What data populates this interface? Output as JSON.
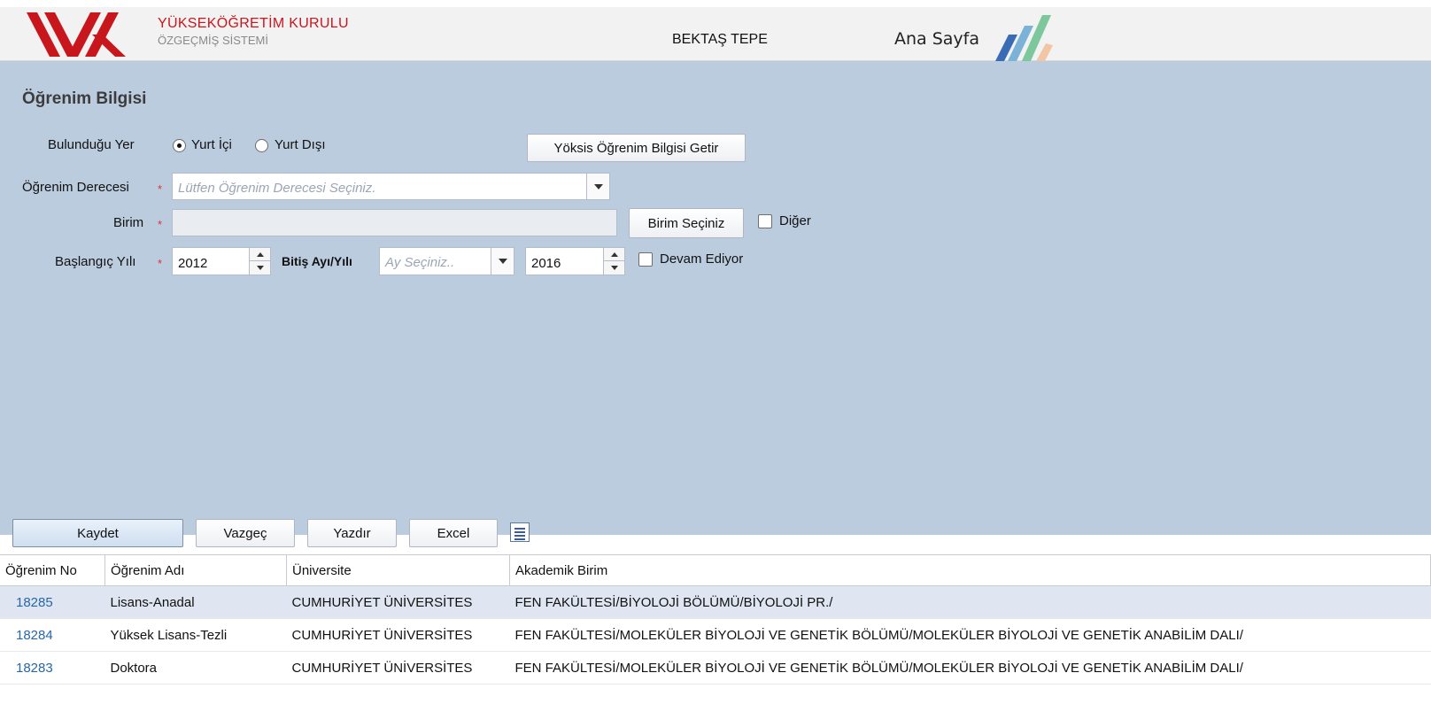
{
  "header": {
    "org_name": "YÜKSEKÖĞRETİM KURULU",
    "org_sub": "ÖZGEÇMİŞ SİSTEMİ",
    "user_name": "BEKTAŞ TEPE",
    "home_link": "Ana Sayfa",
    "logo_color": "#c8161d",
    "stripe_colors": [
      "#3a6cb5",
      "#7ab2d8",
      "#7cc79b",
      "#f2c6a4"
    ]
  },
  "form": {
    "title": "Öğrenim Bilgisi",
    "location_label": "Bulunduğu Yer",
    "location_options": [
      {
        "label": "Yurt İçi",
        "selected": true
      },
      {
        "label": "Yurt Dışı",
        "selected": false
      }
    ],
    "fetch_button": "Yöksis Öğrenim Bilgisi Getir",
    "degree_label": "Öğrenim Derecesi",
    "degree_placeholder": "Lütfen Öğrenim Derecesi Seçiniz.",
    "unit_label": "Birim",
    "unit_value": "",
    "unit_button": "Birim Seçiniz",
    "other_label": "Diğer",
    "other_checked": false,
    "start_label": "Başlangıç Yılı",
    "start_value": "2012",
    "end_label": "Bitiş Ayı/Yılı",
    "end_month_placeholder": "Ay Seçiniz..",
    "end_year_value": "2016",
    "ongoing_label": "Devam Ediyor",
    "ongoing_checked": false,
    "required_mark": "*"
  },
  "toolbar": {
    "save": "Kaydet",
    "cancel": "Vazgeç",
    "print": "Yazdır",
    "excel": "Excel",
    "list_icon": "list-icon"
  },
  "table": {
    "columns": [
      "Öğrenim No",
      "Öğrenim Adı",
      "Üniversite",
      "Akademik Birim"
    ],
    "rows": [
      {
        "no": "18285",
        "name": "Lisans-Anadal",
        "university": "CUMHURİYET ÜNİVERSİTES",
        "unit": "FEN FAKÜLTESİ/BİYOLOJİ BÖLÜMÜ/BİYOLOJİ PR./"
      },
      {
        "no": "18284",
        "name": "Yüksek Lisans-Tezli",
        "university": "CUMHURİYET ÜNİVERSİTES",
        "unit": "FEN FAKÜLTESİ/MOLEKÜLER BİYOLOJİ VE GENETİK BÖLÜMÜ/MOLEKÜLER BİYOLOJİ VE GENETİK ANABİLİM DALI/"
      },
      {
        "no": "18283",
        "name": "Doktora",
        "university": "CUMHURİYET ÜNİVERSİTES",
        "unit": "FEN FAKÜLTESİ/MOLEKÜLER BİYOLOJİ VE GENETİK BÖLÜMÜ/MOLEKÜLER BİYOLOJİ VE GENETİK ANABİLİM DALI/"
      }
    ]
  }
}
